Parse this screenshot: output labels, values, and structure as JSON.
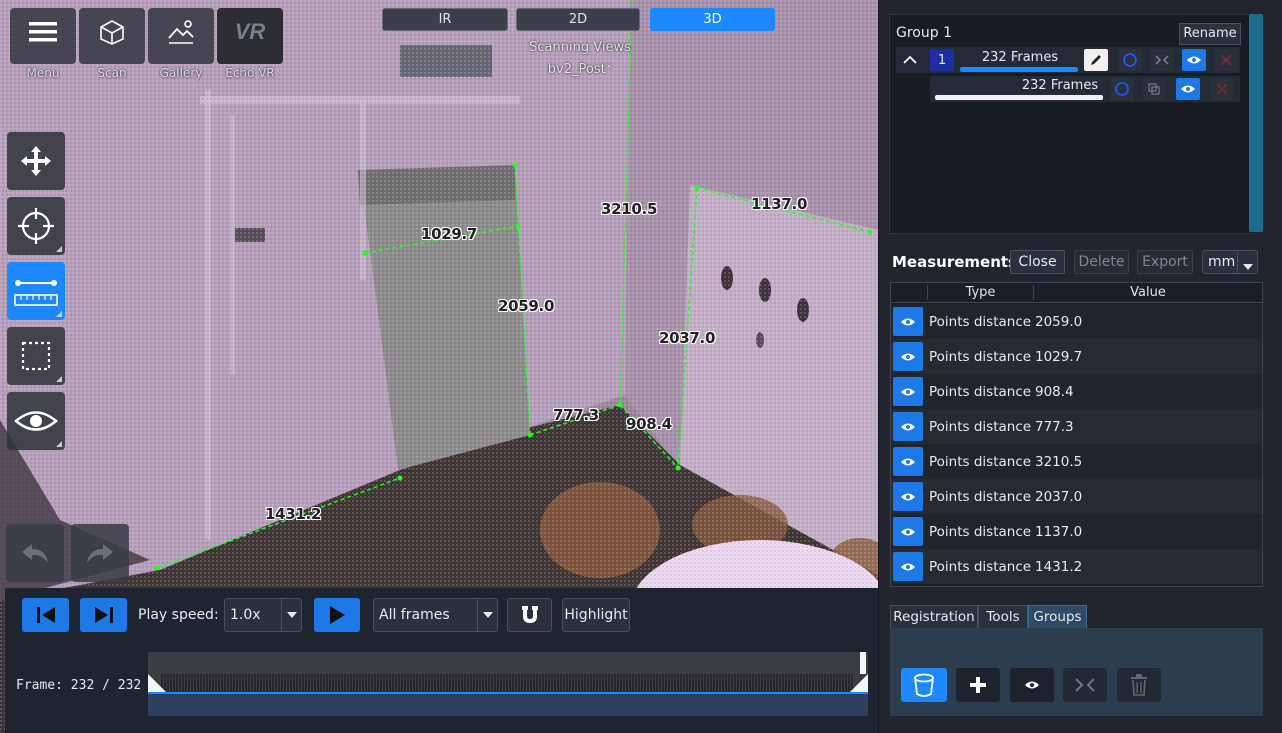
{
  "viewport": {
    "view_tabs": [
      {
        "label": "IR",
        "active": false
      },
      {
        "label": "2D",
        "active": false
      },
      {
        "label": "3D",
        "active": true
      }
    ],
    "subtitle": "Scanning Views",
    "scan_name": "bv2_Post*",
    "top_buttons": [
      {
        "label": "Menu",
        "icon": "hamburger-menu-icon"
      },
      {
        "label": "Scan",
        "icon": "scan-cube-icon"
      },
      {
        "label": "Gallery",
        "icon": "gallery-icon"
      },
      {
        "label": "Echo VR",
        "icon": "vr-icon"
      }
    ],
    "vr_text": "VR",
    "side_tools": [
      {
        "name": "move",
        "icon": "move-arrows-icon",
        "active": false
      },
      {
        "name": "target",
        "icon": "crosshair-icon",
        "active": false
      },
      {
        "name": "measure",
        "icon": "ruler-measure-icon",
        "active": true
      },
      {
        "name": "select",
        "icon": "selection-rect-icon",
        "active": false
      },
      {
        "name": "visibility",
        "icon": "eye-icon",
        "active": false
      }
    ],
    "measure_labels": [
      {
        "text": "1029.7"
      },
      {
        "text": "3210.5"
      },
      {
        "text": "1137.0"
      },
      {
        "text": "2059.0"
      },
      {
        "text": "2037.0"
      },
      {
        "text": "777.3"
      },
      {
        "text": "908.4"
      },
      {
        "text": "1431.2"
      }
    ]
  },
  "playback": {
    "play_speed_label": "Play speed:",
    "play_speed_value": "1.0x",
    "frames_filter": "All frames",
    "highlight_label": "Highlight",
    "frame_label": "Frame: 232 / 232",
    "progress": 1.0
  },
  "groups": {
    "title": "Group 1",
    "rename_label": "Rename",
    "badge": "1",
    "row1_text": "232 Frames",
    "row2_text": "232 Frames"
  },
  "measurements": {
    "title": "Measurements",
    "close_label": "Close",
    "delete_label": "Delete",
    "export_label": "Export",
    "unit": "mm",
    "col_type": "Type",
    "col_value": "Value",
    "rows": [
      {
        "type": "Points distance",
        "value": "2059.0"
      },
      {
        "type": "Points distance",
        "value": "1029.7"
      },
      {
        "type": "Points distance",
        "value": "908.4"
      },
      {
        "type": "Points distance",
        "value": "777.3"
      },
      {
        "type": "Points distance",
        "value": "3210.5"
      },
      {
        "type": "Points distance",
        "value": "2037.0"
      },
      {
        "type": "Points distance",
        "value": "1137.0"
      },
      {
        "type": "Points distance",
        "value": "1431.2"
      }
    ]
  },
  "bottom_tabs": [
    {
      "label": "Registration",
      "active": false
    },
    {
      "label": "Tools",
      "active": false
    },
    {
      "label": "Groups",
      "active": true
    }
  ],
  "colors": {
    "accent": "#1e88ff",
    "measure_line": "#22ff22",
    "panel_bg": "#20252e"
  }
}
